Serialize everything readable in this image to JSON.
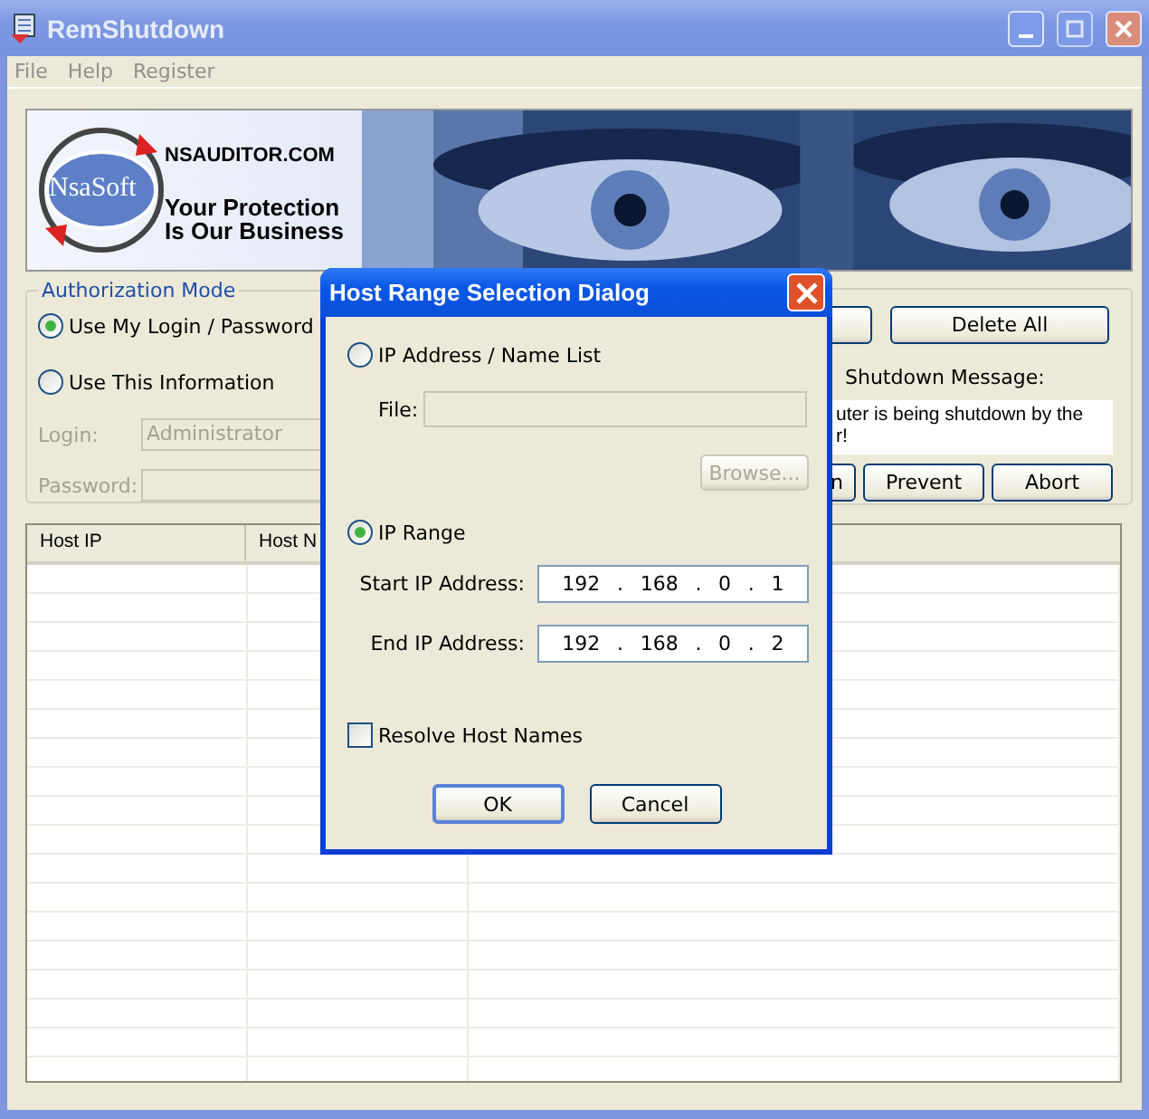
{
  "window": {
    "title": "RemShutdown"
  },
  "menu": [
    "File",
    "Help",
    "Register"
  ],
  "banner": {
    "logo": "NsaSoft",
    "site": "NSAUDITOR.COM",
    "slogan": [
      "Your Protection",
      "Is Our Business"
    ]
  },
  "authorization": {
    "title": "Authorization Mode",
    "options": [
      {
        "label": "Use My Login / Password",
        "selected": true
      },
      {
        "label": "Use This Information",
        "selected": false
      }
    ],
    "fields": [
      {
        "label": "Login:",
        "value": "Administrator",
        "disabled": true
      },
      {
        "label": "Password:",
        "disabled": true
      }
    ]
  },
  "actions": {
    "top_buttons": [
      "Delete All"
    ],
    "message_label": "Shutdown Message:",
    "message_lines": [
      "uter is being shutdown by the",
      "r!"
    ],
    "bottom_buttons": [
      "n",
      "Prevent",
      "Abort"
    ]
  },
  "table": {
    "columns": [
      "Host IP",
      "Host N"
    ]
  },
  "dialog": {
    "title": "Host Range Selection Dialog",
    "modes": [
      {
        "label": "IP Address / Name List",
        "selected": false
      },
      {
        "label": "IP Range",
        "selected": true
      }
    ],
    "file": {
      "label": "File:",
      "disabled": true
    },
    "browse": {
      "label": "Browse...",
      "disabled": true
    },
    "ranges": [
      {
        "label": "Start IP Address:",
        "parts": [
          "192",
          ".",
          "168",
          ".",
          "0",
          ".",
          "1"
        ]
      },
      {
        "label": "End IP Address:",
        "parts": [
          "192",
          ".",
          "168",
          ".",
          "0",
          ".",
          "2"
        ]
      }
    ],
    "resolve": {
      "label": "Resolve Host Names",
      "checked": false
    },
    "buttons": [
      {
        "label": "OK",
        "default": true
      },
      {
        "label": "Cancel",
        "default": false
      }
    ]
  }
}
